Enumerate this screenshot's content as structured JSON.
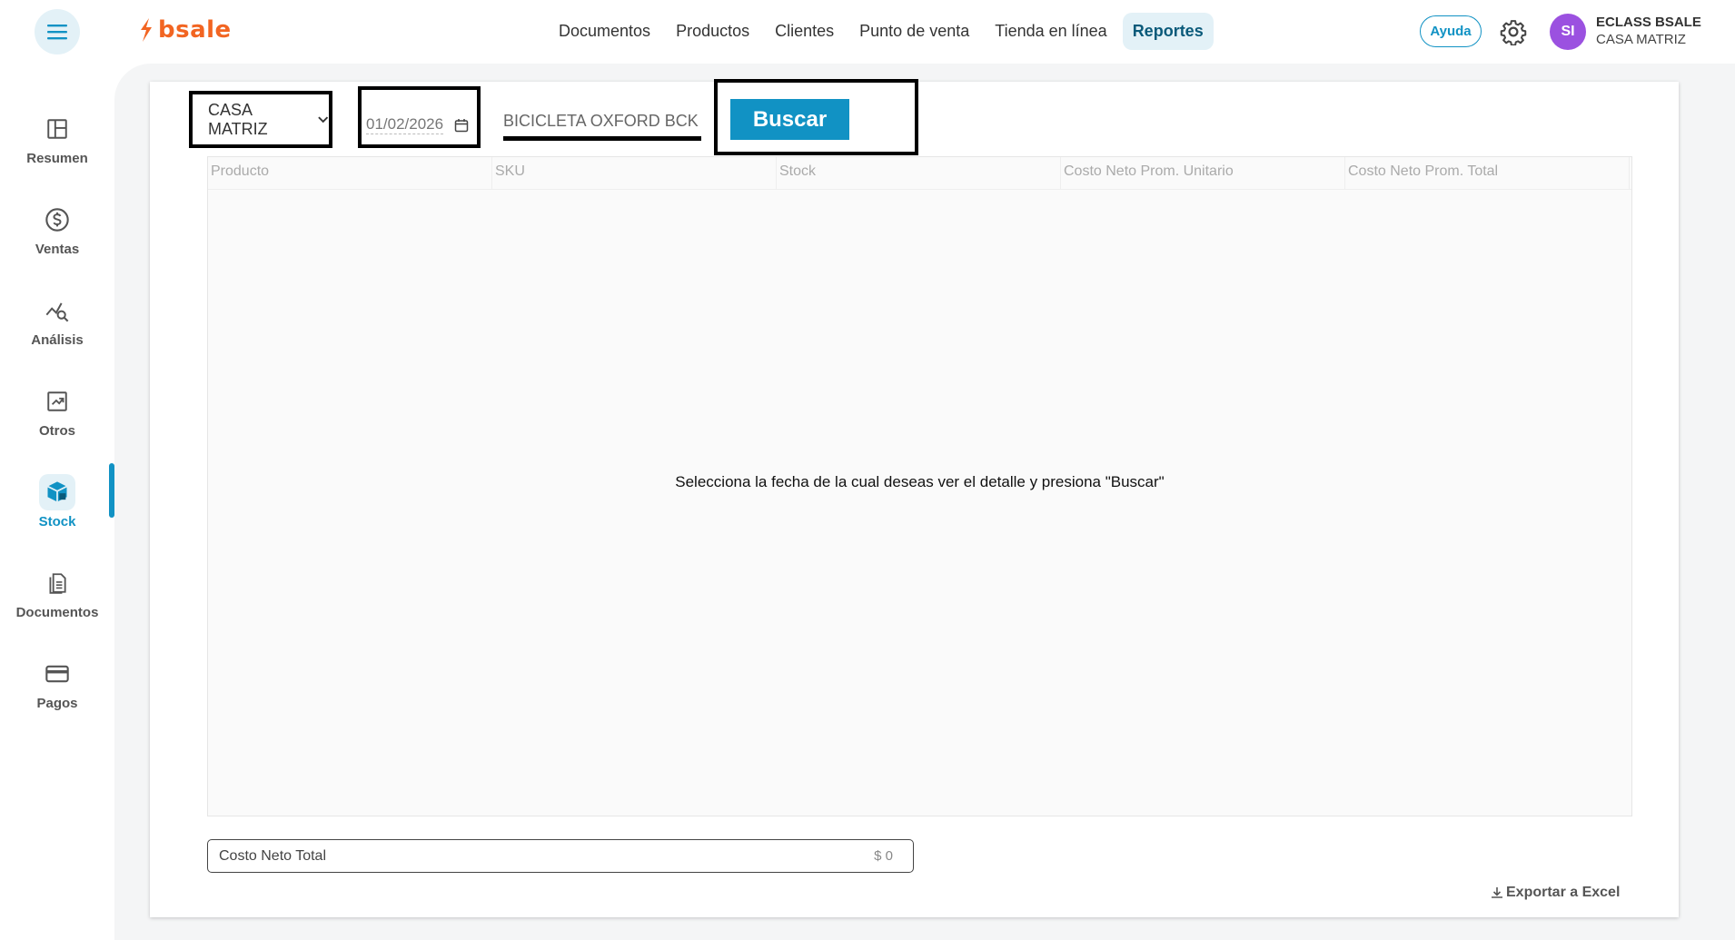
{
  "header": {
    "logo_text": "bsale",
    "nav": [
      {
        "label": "Documentos"
      },
      {
        "label": "Productos"
      },
      {
        "label": "Clientes"
      },
      {
        "label": "Punto de venta"
      },
      {
        "label": "Tienda en línea"
      },
      {
        "label": "Reportes",
        "active": true
      }
    ],
    "help_label": "Ayuda",
    "avatar_initials": "SI",
    "user_name": "ECLASS BSALE",
    "user_branch": "CASA MATRIZ"
  },
  "sidebar": {
    "items": [
      {
        "label": "Resumen",
        "icon": "layout-icon"
      },
      {
        "label": "Ventas",
        "icon": "dollar-icon"
      },
      {
        "label": "Análisis",
        "icon": "analysis-icon"
      },
      {
        "label": "Otros",
        "icon": "chart-trend-icon"
      },
      {
        "label": "Stock",
        "icon": "box-icon",
        "active": true
      },
      {
        "label": "Documentos",
        "icon": "documents-icon"
      },
      {
        "label": "Pagos",
        "icon": "card-icon"
      }
    ]
  },
  "filters": {
    "branch_value": "CASA MATRIZ",
    "date_value": "01/02/2026",
    "product_value": "BICICLETA OXFORD BCK",
    "search_button": "Buscar"
  },
  "table": {
    "columns": [
      "Producto",
      "SKU",
      "Stock",
      "Costo Neto Prom. Unitario",
      "Costo Neto Prom. Total"
    ],
    "empty_message": "Selecciona la fecha de la cual deseas ver el detalle y presiona \"Buscar\""
  },
  "summary": {
    "total_label": "Costo Neto Total",
    "total_value": "$ 0"
  },
  "export_label": "Exportar a Excel",
  "colors": {
    "accent": "#1192c4",
    "brand": "#f26522",
    "avatar": "#9b51e0"
  }
}
